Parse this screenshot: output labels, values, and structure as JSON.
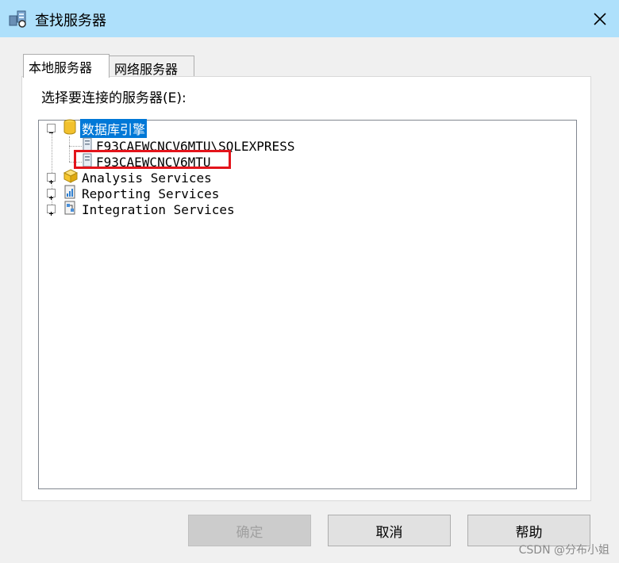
{
  "dialog": {
    "title": "查找服务器",
    "colors": {
      "titlebar": "#aee0fb",
      "selection": "#0078d7",
      "highlight": "#e3141b"
    }
  },
  "tabs": [
    {
      "label": "本地服务器",
      "active": true
    },
    {
      "label": "网络服务器",
      "active": false
    }
  ],
  "prompt": "选择要连接的服务器(E):",
  "tree": {
    "database_engine": {
      "label": "数据库引擎",
      "expanded": true,
      "selected": true,
      "children": [
        {
          "label": "F93CAEWCNCV6MTU\\SQLEXPRESS"
        },
        {
          "label": "F93CAEWCNCV6MTU"
        }
      ]
    },
    "analysis": {
      "label": "Analysis Services",
      "expanded": false
    },
    "reporting": {
      "label": "Reporting Services",
      "expanded": false
    },
    "integration": {
      "label": "Integration Services",
      "expanded": false
    }
  },
  "buttons": {
    "ok": "确定",
    "cancel": "取消",
    "help": "帮助"
  },
  "watermark": "CSDN @分布小姐"
}
